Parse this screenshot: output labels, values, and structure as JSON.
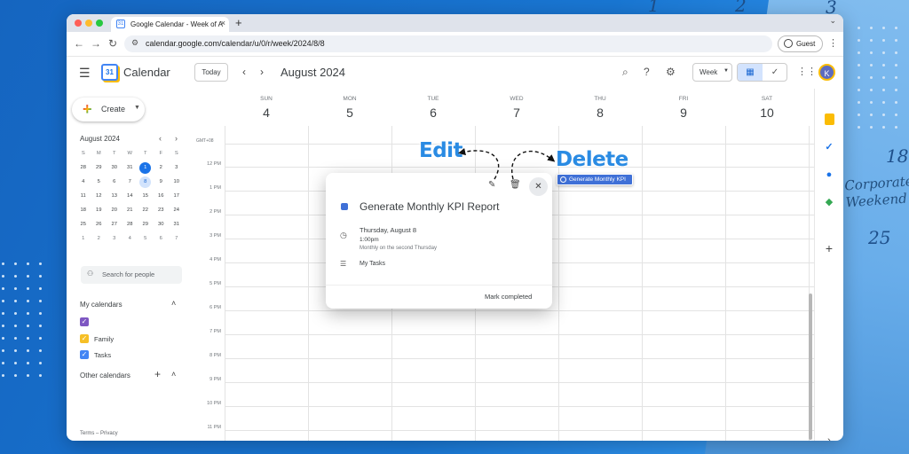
{
  "browser": {
    "tab_title": "Google Calendar - Week of A",
    "tab_icon": "31",
    "tab_close": "×",
    "new_tab": "+",
    "tab_menu": "⌄",
    "url": "calendar.google.com/calendar/u/0/r/week/2024/8/8",
    "profile_label": "Guest"
  },
  "header": {
    "app_name": "Calendar",
    "logo_text": "31",
    "today_label": "Today",
    "month_label": "August 2024",
    "view_label": "Week",
    "avatar_letter": "K"
  },
  "sidebar": {
    "create_label": "Create",
    "mini_month": "August 2024",
    "mini_dows": [
      "S",
      "M",
      "T",
      "W",
      "T",
      "F",
      "S"
    ],
    "mini_weeks": [
      [
        "28",
        "29",
        "30",
        "31",
        "1",
        "2",
        "3"
      ],
      [
        "4",
        "5",
        "6",
        "7",
        "8",
        "9",
        "10"
      ],
      [
        "11",
        "12",
        "13",
        "14",
        "15",
        "16",
        "17"
      ],
      [
        "18",
        "19",
        "20",
        "21",
        "22",
        "23",
        "24"
      ],
      [
        "25",
        "26",
        "27",
        "28",
        "29",
        "30",
        "31"
      ],
      [
        "1",
        "2",
        "3",
        "4",
        "5",
        "6",
        "7"
      ]
    ],
    "search_people_placeholder": "Search for people",
    "my_calendars_title": "My calendars",
    "calendars": [
      {
        "label": "",
        "color": "#7e57c2"
      },
      {
        "label": "Family",
        "color": "#f6bf26"
      },
      {
        "label": "Tasks",
        "color": "#4285f4"
      }
    ],
    "other_calendars_title": "Other calendars",
    "footer": "Terms – Privacy"
  },
  "grid": {
    "timezone": "GMT+08",
    "days": [
      {
        "name": "SUN",
        "num": "4"
      },
      {
        "name": "MON",
        "num": "5"
      },
      {
        "name": "TUE",
        "num": "6"
      },
      {
        "name": "WED",
        "num": "7"
      },
      {
        "name": "THU",
        "num": "8"
      },
      {
        "name": "FRI",
        "num": "9"
      },
      {
        "name": "SAT",
        "num": "10"
      }
    ],
    "hours": [
      "12 PM",
      "1 PM",
      "2 PM",
      "3 PM",
      "4 PM",
      "5 PM",
      "6 PM",
      "7 PM",
      "8 PM",
      "9 PM",
      "10 PM",
      "11 PM"
    ]
  },
  "event_chip": {
    "label": "Generate Monthly KPI"
  },
  "popup": {
    "title": "Generate Monthly KPI Report",
    "date": "Thursday, August 8",
    "time": "1:00pm",
    "recurrence": "Monthly on the second Thursday",
    "list": "My Tasks",
    "mark_completed": "Mark completed",
    "close": "✕"
  },
  "annotations": {
    "edit_label": "Edit",
    "delete_label": "Delete"
  },
  "background": {
    "numbers": [
      "1",
      "2",
      "3",
      "18",
      "25"
    ],
    "note": "Corporate Weekend"
  },
  "colors": {
    "accent": "#1a73e8",
    "event": "#3f70d7",
    "callout": "#2a8be3"
  }
}
